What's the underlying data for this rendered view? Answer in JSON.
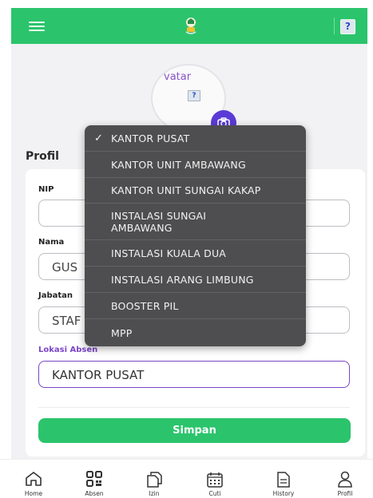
{
  "header": {
    "menu_icon": "hamburger-menu-icon",
    "logo_icon": "app-logo-icon",
    "help_icon": "broken-image-icon",
    "help_glyph": "?"
  },
  "profile": {
    "avatar_alt": "vatar",
    "avatar_glyph": "?",
    "camera_icon": "camera-icon",
    "section_title": "Profil"
  },
  "form": {
    "nip": {
      "label": "NIP",
      "value": ""
    },
    "nama": {
      "label": "Nama",
      "value": "GUS"
    },
    "jabatan": {
      "label": "Jabatan",
      "value": "STAF"
    },
    "lokasi": {
      "label": "Lokasi Absen",
      "value": "KANTOR PUSAT"
    },
    "save_label": "Simpan"
  },
  "dropdown": {
    "check": "✓",
    "options": [
      "KANTOR PUSAT",
      "KANTOR UNIT AMBAWANG",
      "KANTOR UNIT SUNGAI KAKAP",
      "INSTALASI SUNGAI AMBAWANG",
      "INSTALASI KUALA DUA",
      "INSTALASI ARANG LIMBUNG",
      "BOOSTER PIL",
      "MPP"
    ],
    "selected": "KANTOR PUSAT"
  },
  "bottom_nav": [
    {
      "label": "Home",
      "icon": "home-icon"
    },
    {
      "label": "Absen",
      "icon": "qr-code-icon"
    },
    {
      "label": "Izin",
      "icon": "copy-document-icon"
    },
    {
      "label": "Cuti",
      "icon": "calendar-icon"
    },
    {
      "label": "History",
      "icon": "document-icon"
    },
    {
      "label": "Profil",
      "icon": "user-icon"
    }
  ],
  "colors": {
    "primary_green": "#2bc46c",
    "accent_purple": "#7a45c8",
    "dropdown_bg": "#4e4e50"
  }
}
